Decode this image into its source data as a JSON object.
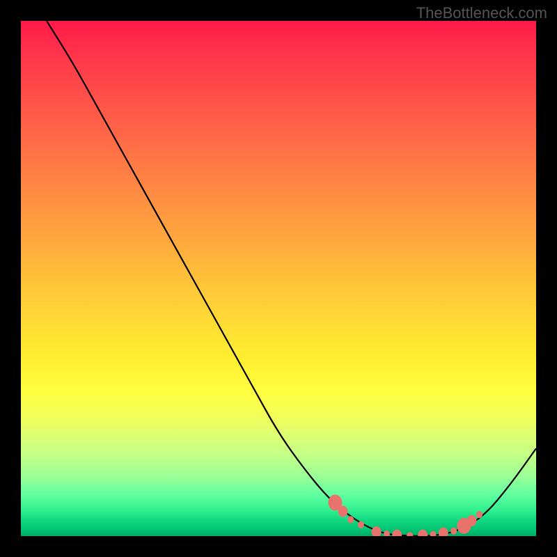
{
  "attribution": "TheBottleneck.com",
  "chart_data": {
    "type": "line",
    "title": "",
    "xlabel": "",
    "ylabel": "",
    "xlim": [
      0,
      100
    ],
    "ylim": [
      0,
      100
    ],
    "series": [
      {
        "name": "curve",
        "points": [
          {
            "x": 5,
            "y": 100
          },
          {
            "x": 10,
            "y": 92
          },
          {
            "x": 15,
            "y": 83
          },
          {
            "x": 20,
            "y": 74
          },
          {
            "x": 25,
            "y": 65
          },
          {
            "x": 30,
            "y": 56
          },
          {
            "x": 35,
            "y": 47
          },
          {
            "x": 40,
            "y": 38
          },
          {
            "x": 45,
            "y": 29
          },
          {
            "x": 50,
            "y": 20
          },
          {
            "x": 55,
            "y": 13
          },
          {
            "x": 60,
            "y": 7
          },
          {
            "x": 65,
            "y": 3
          },
          {
            "x": 70,
            "y": 0.5
          },
          {
            "x": 75,
            "y": 0
          },
          {
            "x": 80,
            "y": 0
          },
          {
            "x": 85,
            "y": 1
          },
          {
            "x": 90,
            "y": 4
          },
          {
            "x": 95,
            "y": 10
          },
          {
            "x": 100,
            "y": 17
          }
        ]
      }
    ],
    "markers": [
      {
        "x": 61,
        "y": 6.5,
        "size": "large"
      },
      {
        "x": 62.5,
        "y": 4.8,
        "size": "medium"
      },
      {
        "x": 64,
        "y": 3.2,
        "size": "small"
      },
      {
        "x": 66,
        "y": 2.2,
        "size": "small"
      },
      {
        "x": 69,
        "y": 0.8,
        "size": "medium"
      },
      {
        "x": 71,
        "y": 0.4,
        "size": "small"
      },
      {
        "x": 73,
        "y": 0.2,
        "size": "medium"
      },
      {
        "x": 75.5,
        "y": 0.1,
        "size": "small"
      },
      {
        "x": 78,
        "y": 0.2,
        "size": "medium"
      },
      {
        "x": 80,
        "y": 0.3,
        "size": "small"
      },
      {
        "x": 82,
        "y": 0.6,
        "size": "medium"
      },
      {
        "x": 84,
        "y": 1.0,
        "size": "small"
      },
      {
        "x": 86,
        "y": 2.0,
        "size": "large"
      },
      {
        "x": 87.5,
        "y": 3.0,
        "size": "medium"
      },
      {
        "x": 89,
        "y": 4.2,
        "size": "small"
      }
    ],
    "gradient_background": {
      "top_color": "#ff1a4a",
      "bottom_color": "#00a860",
      "description": "Vertical gradient from red (top) through orange, yellow, to green (bottom)"
    }
  }
}
